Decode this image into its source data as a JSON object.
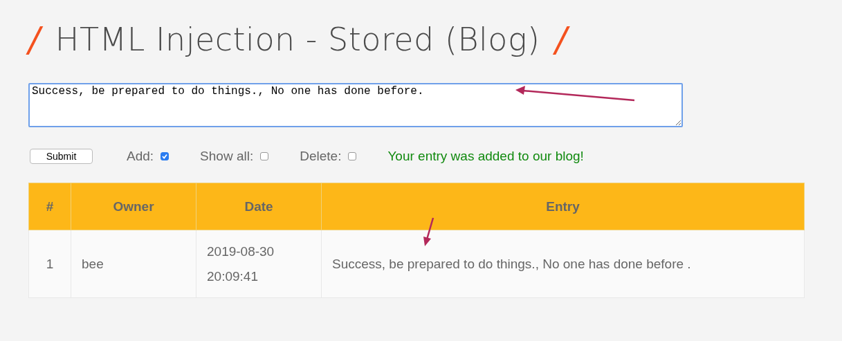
{
  "title": {
    "mark_left": "/",
    "text": "HTML Injection - Stored (Blog)",
    "mark_right": "/"
  },
  "entry_field": {
    "value": "Success, be prepared to do things., No one has done before."
  },
  "controls": {
    "submit": "Submit",
    "options": [
      {
        "label": "Add:",
        "checked": true
      },
      {
        "label": "Show all:",
        "checked": false
      },
      {
        "label": "Delete:",
        "checked": false
      }
    ],
    "message": "Your entry was added to our blog!"
  },
  "table": {
    "columns": [
      "#",
      "Owner",
      "Date",
      "Entry"
    ],
    "rows": [
      [
        "1",
        "bee",
        "2019-08-30 20:09:41",
        "Success, be prepared to do things., No one has done before ."
      ]
    ]
  }
}
